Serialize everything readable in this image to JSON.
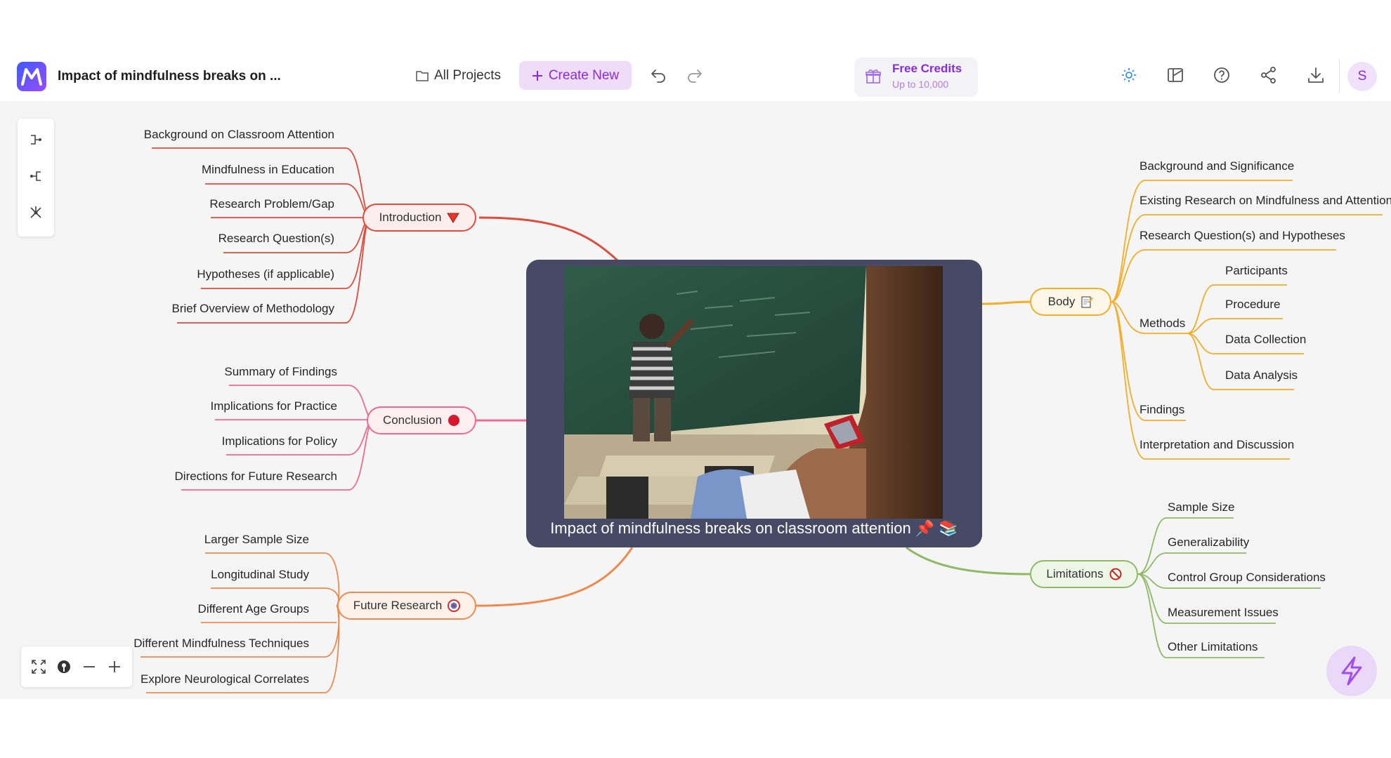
{
  "header": {
    "doc_title": "Impact of mindfulness breaks on ...",
    "all_projects_label": "All Projects",
    "create_new_label": "Create New",
    "credits_title": "Free Credits",
    "credits_sub": "Up to 10,000",
    "avatar_letter": "S"
  },
  "colors": {
    "accent": "#8a2be2",
    "introduction": "#e14b3b",
    "conclusion": "#ee6b8f",
    "future_research": "#ef8a4f",
    "body": "#f3ad27",
    "limitations": "#8fba66",
    "central_bg": "#474a64"
  },
  "central": {
    "title": "Impact of mindfulness breaks on classroom attention",
    "emoji": "📌 📚"
  },
  "branches": {
    "introduction": {
      "label": "Introduction",
      "icon": "red-triangle-down-icon",
      "children": [
        "Background on Classroom Attention",
        "Mindfulness in Education",
        "Research Problem/Gap",
        "Research Question(s)",
        "Hypotheses (if applicable)",
        "Brief Overview of Methodology"
      ]
    },
    "conclusion": {
      "label": "Conclusion",
      "icon": "red-circle-icon",
      "children": [
        "Summary of Findings",
        "Implications for Practice",
        "Implications for Policy",
        "Directions for Future Research"
      ]
    },
    "future_research": {
      "label": "Future Research",
      "icon": "target-icon",
      "children": [
        "Larger Sample Size",
        "Longitudinal Study",
        "Different Age Groups",
        "Different Mindfulness Techniques",
        "Explore Neurological Correlates"
      ]
    },
    "body": {
      "label": "Body",
      "icon": "memo-icon",
      "children": [
        "Background and Significance",
        "Existing Research on Mindfulness and Attention",
        "Research Question(s) and Hypotheses",
        "Methods",
        "Findings",
        "Interpretation and Discussion"
      ],
      "methods_children": [
        "Participants",
        "Procedure",
        "Data Collection",
        "Data Analysis"
      ]
    },
    "limitations": {
      "label": "Limitations",
      "icon": "no-entry-icon",
      "children": [
        "Sample Size",
        "Generalizability",
        "Control Group Considerations",
        "Measurement Issues",
        "Other Limitations"
      ]
    }
  }
}
